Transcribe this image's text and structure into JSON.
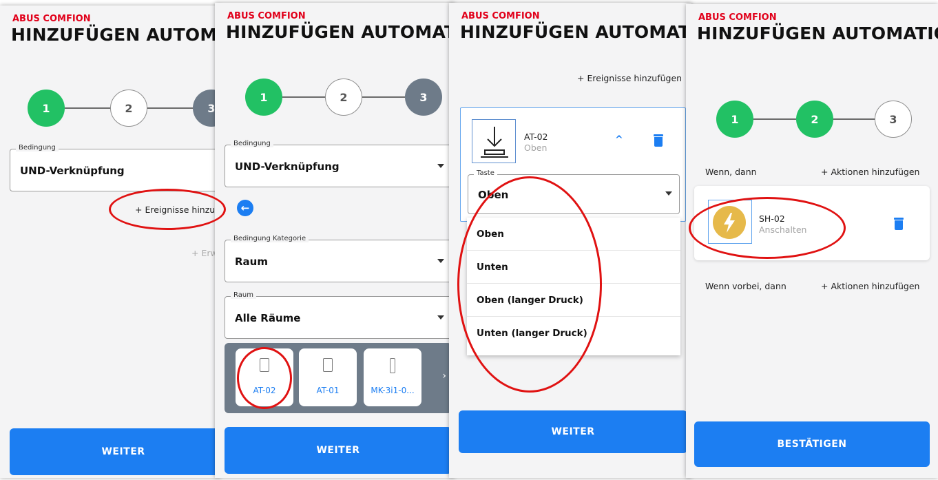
{
  "app": {
    "brand": "ABUS COMFION",
    "title": "HINZUFÜGEN AUTOMATION"
  },
  "colors": {
    "brand_red": "#e1001a",
    "step_done": "#22c164",
    "primary": "#1c7ef2",
    "step_grey": "#6e7b89",
    "annotation": "#e01212"
  },
  "screen1": {
    "steps": [
      "1",
      "2",
      "3"
    ],
    "condition": {
      "legend": "Bedingung",
      "value": "UND-Verknüpfung"
    },
    "add_events": "+ Ereignisse hinzuf",
    "advanced": "+ Erw",
    "next_button": "WEITER"
  },
  "screen2": {
    "steps": [
      "1",
      "2",
      "3"
    ],
    "condition": {
      "legend": "Bedingung",
      "value": "UND-Verknüpfung"
    },
    "category": {
      "legend": "Bedingung Kategorie",
      "value": "Raum"
    },
    "room": {
      "legend": "Raum",
      "value": "Alle Räume"
    },
    "devices": [
      {
        "label": "AT-02",
        "icon": "door-icon"
      },
      {
        "label": "AT-01",
        "icon": "door-icon"
      },
      {
        "label": "MK-3i1-0...",
        "icon": "contact-icon"
      }
    ],
    "next_button": "WEITER"
  },
  "screen3": {
    "add_events": "+ Ereignisse hinzufügen",
    "device": {
      "name": "AT-02",
      "state": "Oben"
    },
    "key_field": {
      "legend": "Taste",
      "value": "Oben"
    },
    "options": [
      "Oben",
      "Unten",
      "Oben (langer Druck)",
      "Unten (langer Druck)"
    ],
    "next_button": "WEITER"
  },
  "screen4": {
    "steps": [
      "1",
      "2",
      "3"
    ],
    "when_then": "Wenn, dann",
    "add_actions": "+ Aktionen hinzufügen",
    "action": {
      "name": "SH-02",
      "state": "Anschalten"
    },
    "when_past": "Wenn vorbei, dann",
    "add_actions_2": "+ Aktionen hinzufügen",
    "confirm_button": "BESTÄTIGEN"
  }
}
